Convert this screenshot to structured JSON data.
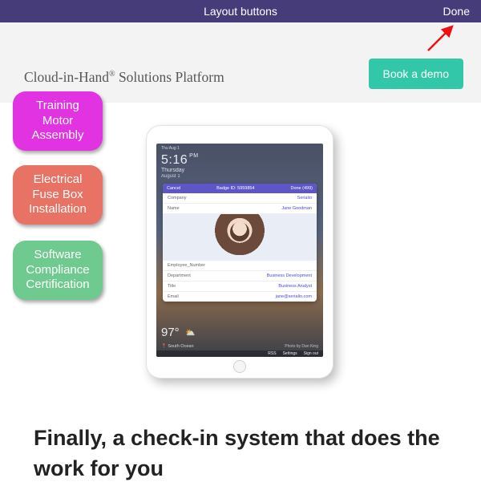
{
  "topbar": {
    "title": "Layout buttons",
    "done": "Done"
  },
  "brand": {
    "pre": "Cloud-in-Hand",
    "reg": "®",
    "post": " Solutions Platform"
  },
  "cta": {
    "demo": "Book a demo"
  },
  "layout_buttons": [
    {
      "label": "Training\nMotor\nAssembly",
      "color": "#e233e2"
    },
    {
      "label": "Electrical\nFuse Box\nInstallation",
      "color": "#e87264"
    },
    {
      "label": "Software\nCompliance\nCertification",
      "color": "#6fca8f"
    }
  ],
  "tablet": {
    "status_time_small": "Thu Aug 1",
    "time": "5:16",
    "ampm": "PM",
    "day": "Thursday",
    "date": "August 1",
    "card": {
      "cancel": "Cancel",
      "badge": "Badge ID: 5959854",
      "done": "Done (499)",
      "rows_top": [
        {
          "k": "Company",
          "v": "Serialio"
        },
        {
          "k": "Name",
          "v": "Jane Goodman"
        }
      ],
      "rows_bottom": [
        {
          "k": "Employee_Number",
          "v": ""
        },
        {
          "k": "Department",
          "v": "Business Development"
        },
        {
          "k": "Title",
          "v": "Business Analyst"
        },
        {
          "k": "Email",
          "v": "jane@serialio.com"
        }
      ]
    },
    "weather": {
      "temp": "97°",
      "icon": "⛅"
    },
    "location": "South Ocean",
    "photo_credit": "Photo by Dan King",
    "footer": [
      "RSS",
      "Settings",
      "Sign out"
    ]
  },
  "headline": "Finally, a check-in system that does the work for you"
}
